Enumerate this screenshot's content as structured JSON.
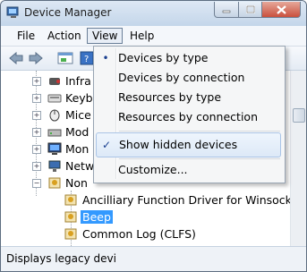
{
  "window": {
    "title": "Device Manager"
  },
  "menubar": {
    "items": [
      "File",
      "Action",
      "View",
      "Help"
    ],
    "open_menu": "View"
  },
  "toolbar": {
    "buttons": [
      "back-icon",
      "forward-icon",
      "properties-icon",
      "help-icon"
    ]
  },
  "tree": {
    "items": [
      {
        "label": "Infra",
        "icon": "infrared-icon",
        "state": "collapsed"
      },
      {
        "label": "Keyb",
        "icon": "keyboard-icon",
        "state": "collapsed"
      },
      {
        "label": "Mice",
        "icon": "mouse-icon",
        "state": "collapsed"
      },
      {
        "label": "Mod",
        "icon": "modem-icon",
        "state": "collapsed"
      },
      {
        "label": "Mon",
        "icon": "monitor-icon",
        "state": "collapsed"
      },
      {
        "label": "Netw",
        "icon": "network-icon",
        "state": "collapsed"
      },
      {
        "label": "Non",
        "icon": "non-pnp-icon",
        "state": "expanded"
      }
    ],
    "children": [
      {
        "label": "Ancilliary Function Driver for Winsock",
        "selected": false
      },
      {
        "label": "Beep",
        "selected": true
      },
      {
        "label": "Common Log (CLFS)",
        "selected": false
      }
    ]
  },
  "view_menu": {
    "items": [
      {
        "label": "Devices by type",
        "mark": "•"
      },
      {
        "label": "Devices by connection",
        "mark": ""
      },
      {
        "label": "Resources by type",
        "mark": ""
      },
      {
        "label": "Resources by connection",
        "mark": ""
      },
      {
        "label": "Show hidden devices",
        "mark": "✓",
        "hover": true
      },
      {
        "label": "Customize...",
        "mark": ""
      }
    ]
  },
  "statusbar": {
    "text": "Displays legacy devi"
  },
  "colors": {
    "selection": "#3399ff",
    "titlebar": "#c9d9ea",
    "close_button": "#c9503d"
  }
}
